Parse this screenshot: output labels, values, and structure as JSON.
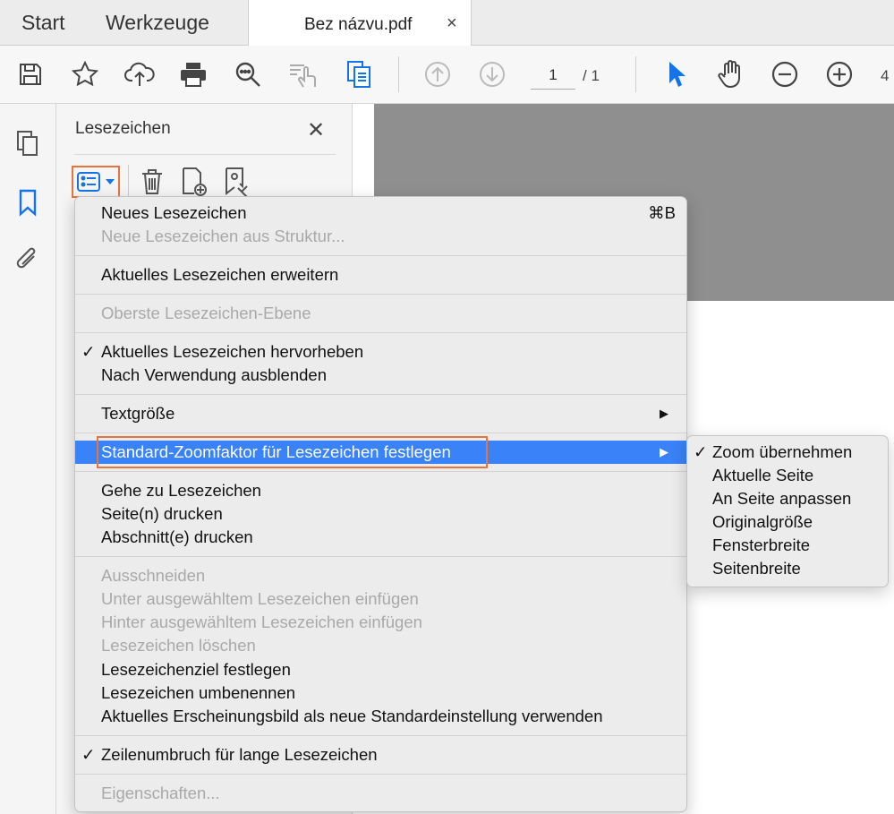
{
  "tabs": {
    "start": "Start",
    "tools": "Werkzeuge",
    "document": "Bez názvu.pdf",
    "close": "×"
  },
  "toolbar": {
    "page_current": "1",
    "page_total": "/ 1",
    "overflow": "4"
  },
  "panel": {
    "title": "Lesezeichen",
    "close": "✕"
  },
  "menu": {
    "new_bookmark": "Neues Lesezeichen",
    "new_bookmark_shortcut": "⌘B",
    "new_from_structure": "Neue Lesezeichen aus Struktur...",
    "expand_current": "Aktuelles Lesezeichen erweitern",
    "top_level": "Oberste Lesezeichen-Ebene",
    "highlight_current": "Aktuelles Lesezeichen hervorheben",
    "hide_after_use": "Nach Verwendung ausblenden",
    "text_size": "Textgröße",
    "set_default_zoom": "Standard-Zoomfaktor für Lesezeichen festlegen",
    "goto_bookmark": "Gehe zu Lesezeichen",
    "print_pages": "Seite(n) drucken",
    "print_sections": "Abschnitt(e) drucken",
    "cut": "Ausschneiden",
    "paste_under": "Unter ausgewähltem Lesezeichen einfügen",
    "paste_after": "Hinter ausgewähltem Lesezeichen einfügen",
    "delete_bookmarks": "Lesezeichen löschen",
    "set_destination": "Lesezeichenziel festlegen",
    "rename_bookmarks": "Lesezeichen umbenennen",
    "use_current_appearance": "Aktuelles Erscheinungsbild als neue Standardeinstellung verwenden",
    "wrap_long": "Zeilenumbruch für lange Lesezeichen",
    "properties": "Eigenschaften...",
    "check": "✓",
    "arrow": "▶"
  },
  "submenu": {
    "inherit_zoom": "Zoom übernehmen",
    "current_page": "Aktuelle Seite",
    "fit_page": "An Seite anpassen",
    "original_size": "Originalgröße",
    "window_width": "Fensterbreite",
    "page_width": "Seitenbreite",
    "check": "✓"
  },
  "colors": {
    "accent": "#1473e6",
    "highlight": "#3a82f7",
    "focus_frame": "#e8743b"
  },
  "icons": [
    "save-icon",
    "star-icon",
    "cloud-upload-icon",
    "print-icon",
    "zoom-search-icon",
    "touch-reading-icon",
    "pages-icon",
    "arrow-up-icon",
    "arrow-down-icon",
    "cursor-icon",
    "hand-icon",
    "zoom-out-icon",
    "zoom-in-icon",
    "page-thumbnails-icon",
    "bookmark-icon",
    "paperclip-icon",
    "options-list-icon",
    "trash-icon",
    "new-bookmark-icon",
    "bookmark-settings-icon"
  ]
}
